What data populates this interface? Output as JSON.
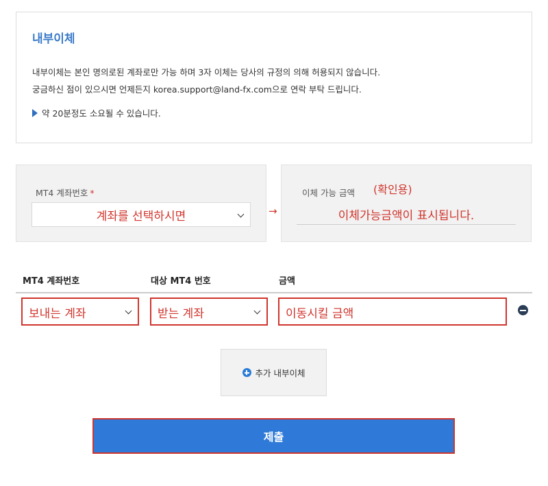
{
  "info": {
    "title": "내부이체",
    "line1": "내부이체는 본인 명의로된 계좌로만 가능 하며 3자 이체는 당사의 규정의 의해 허용되지 않습니다.",
    "line2": "궁금하신 점이 있으시면 언제든지 korea.support@land-fx.com으로 연락 부탁 드립니다.",
    "note": "약 20분정도 소요될 수 있습니다."
  },
  "account_panel": {
    "label": "MT4 계좌번호",
    "required_mark": "*",
    "select_placeholder": "계좌를 선택하시면"
  },
  "amount_panel": {
    "label": "이체 가능 금액",
    "hint": "(확인용)",
    "display": "이체가능금액이 표시됩니다."
  },
  "arrow": "→",
  "transfer_table": {
    "columns": [
      "MT4 계좌번호",
      "대상 MT4 번호",
      "금액"
    ],
    "row": {
      "from_account": "보내는 계좌",
      "to_account": "받는 계좌",
      "amount": "이동시킬 금액"
    }
  },
  "add_button": {
    "label": "추가 내부이체",
    "icon": "plus-circle-icon"
  },
  "remove_icon": "minus-circle-icon",
  "submit_button": {
    "label": "제출"
  },
  "colors": {
    "title_blue": "#3a7bc8",
    "annotation_red": "#d0342c",
    "submit_blue": "#2f7ad8",
    "panel_gray": "#f2f2f2"
  }
}
